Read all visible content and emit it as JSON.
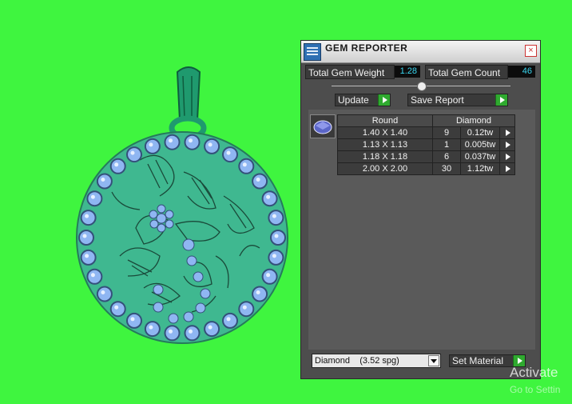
{
  "panel": {
    "title": "GEM REPORTER",
    "close_glyph": "×",
    "total_weight_label": "Total Gem Weight",
    "total_weight_value": "1.28",
    "total_count_label": "Total Gem Count",
    "total_count_value": "46",
    "update_label": "Update",
    "save_report_label": "Save Report",
    "table": {
      "headers": [
        "Round",
        "Diamond"
      ],
      "rows": [
        {
          "size": "1.40 X 1.40",
          "count": "9",
          "weight": "0.12tw"
        },
        {
          "size": "1.13 X 1.13",
          "count": "1",
          "weight": "0.005tw"
        },
        {
          "size": "1.18 X 1.18",
          "count": "6",
          "weight": "0.037tw"
        },
        {
          "size": "2.00 X 2.00",
          "count": "30",
          "weight": "1.12tw"
        }
      ]
    },
    "material_select": "Diamond    (3.52 spg)",
    "set_material_label": "Set Material"
  },
  "watermark": {
    "line1": "Activate",
    "line2": "Go to Settin"
  },
  "colors": {
    "background": "#3ff53f",
    "pendant": "#3fb890",
    "gem": "#8fb6f2",
    "accent_green": "#2faa2f",
    "value_cyan": "#3ad6f0"
  }
}
